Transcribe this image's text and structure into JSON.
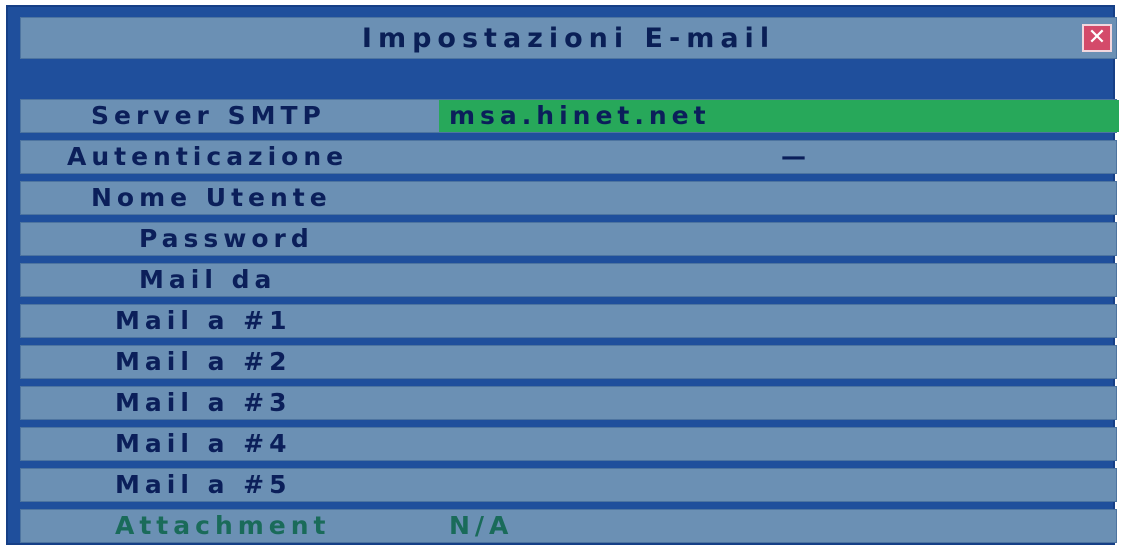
{
  "dialog": {
    "title": "Impostazioni E-mail",
    "close_label": "✕"
  },
  "rows": [
    {
      "label": "Server SMTP",
      "value": "msa.hinet.net"
    },
    {
      "label": "Autenticazione",
      "value": "—"
    },
    {
      "label": "Nome Utente",
      "value": ""
    },
    {
      "label": "Password",
      "value": ""
    },
    {
      "label": "Mail da",
      "value": ""
    },
    {
      "label": "Mail a #1",
      "value": ""
    },
    {
      "label": "Mail a #2",
      "value": ""
    },
    {
      "label": "Mail a #3",
      "value": ""
    },
    {
      "label": "Mail a #4",
      "value": ""
    },
    {
      "label": "Mail a #5",
      "value": ""
    },
    {
      "label": "Attachment",
      "value": "N/A"
    }
  ],
  "colors": {
    "frame": "#1f4f9c",
    "row": "#6b90b4",
    "highlight": "#27a85a",
    "close": "#d44a6a"
  }
}
